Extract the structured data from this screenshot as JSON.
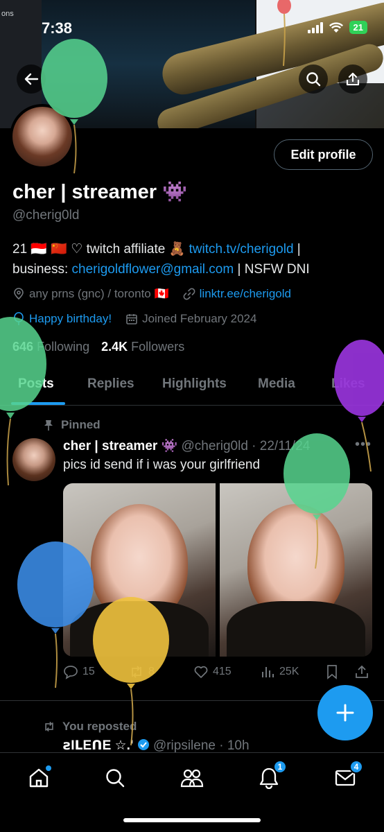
{
  "status_bar": {
    "time": "7:38",
    "battery": "21"
  },
  "banner": {
    "left_text": "ons"
  },
  "profile": {
    "name": "cher | streamer",
    "name_emoji": "👾",
    "handle": "@cherig0ld",
    "edit_button": "Edit profile",
    "bio_line1_prefix": "21 🇮🇩 🇨🇳 ♡ twitch affiliate 🧸 ",
    "bio_link1": "twitch.tv/cherigold",
    "bio_line1_suffix": " |",
    "bio_line2_prefix": "business: ",
    "bio_link2": "cherigoldflower@gmail.com",
    "bio_line2_suffix": " | NSFW DNI",
    "location": "any prns (gnc) / toronto 🇨🇦",
    "website": "linktr.ee/cherigold",
    "birthday": "Happy birthday!",
    "joined": "Joined February 2024",
    "following_count": "646",
    "following_label": "Following",
    "followers_count": "2.4K",
    "followers_label": "Followers"
  },
  "tabs": [
    "Posts",
    "Replies",
    "Highlights",
    "Media",
    "Likes"
  ],
  "pinned_post": {
    "pinned_label": "Pinned",
    "author": "cher | streamer 👾",
    "handle_date": "@cherig0ld · 22/11/24",
    "text": "pics id send if i was your girlfriend",
    "replies": "15",
    "reposts": "8",
    "likes": "415",
    "views": "25K"
  },
  "second_post": {
    "reposted_label": "You reposted",
    "author": "ꙅIᒪEᑎE ☆.'",
    "handle_time": "@ripsilene · 10h"
  },
  "bottom_nav": {
    "notifications_badge": "1",
    "messages_badge": "4"
  },
  "colors": {
    "accent": "#1d9bf0",
    "background": "#000000",
    "muted": "#71767b"
  }
}
